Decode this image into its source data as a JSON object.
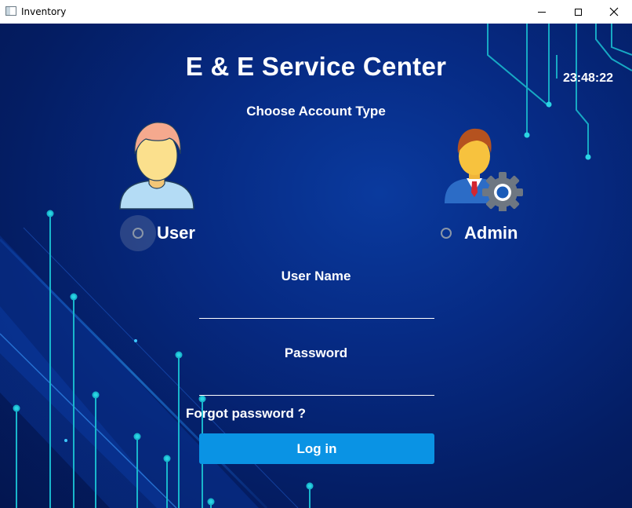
{
  "window": {
    "title": "Inventory",
    "controls": [
      "minimize",
      "maximize",
      "close"
    ]
  },
  "app": {
    "title": "E & E Service Center",
    "clock": "23:48:22"
  },
  "account": {
    "prompt": "Choose Account Type",
    "options": [
      {
        "label": "User",
        "icon": "user-avatar-icon",
        "selected": false
      },
      {
        "label": "Admin",
        "icon": "admin-avatar-gear-icon",
        "selected": false
      }
    ]
  },
  "form": {
    "username_label": "User Name",
    "username_value": "",
    "password_label": "Password",
    "password_value": "",
    "forgot_link": "Forgot password ?",
    "login_button": "Log in"
  },
  "colors": {
    "background": "#062a83",
    "login_button": "#0a93e4",
    "circuit_lines": "#1ec6d6",
    "text": "#ffffff"
  }
}
